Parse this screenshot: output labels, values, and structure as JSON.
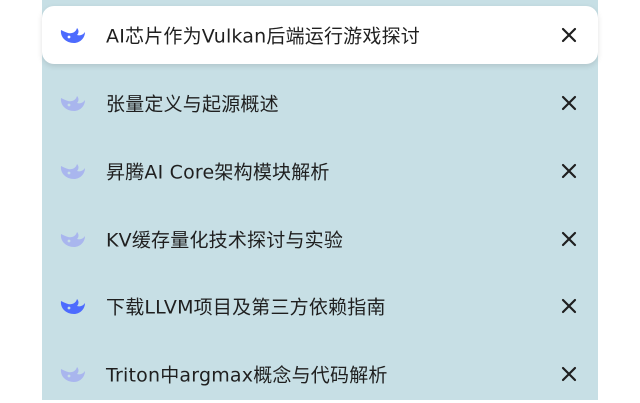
{
  "colors": {
    "panel_bg": "#c7dfe5",
    "active_bg": "#ffffff",
    "logo_strong": "#4d6bfe",
    "logo_faded": "#a9b6ee",
    "text": "#1f1f1f",
    "close": "#1f1f1f"
  },
  "conversations": [
    {
      "title": "AI芯片作为Vulkan后端运行游戏探讨",
      "active": true,
      "logo": "deepseek-whale-icon",
      "logo_style": "strong"
    },
    {
      "title": "张量定义与起源概述",
      "active": false,
      "logo": "deepseek-whale-icon",
      "logo_style": "faded"
    },
    {
      "title": "昇腾AI Core架构模块解析",
      "active": false,
      "logo": "deepseek-whale-icon",
      "logo_style": "faded"
    },
    {
      "title": "KV缓存量化技术探讨与实验",
      "active": false,
      "logo": "deepseek-whale-icon",
      "logo_style": "faded"
    },
    {
      "title": "下载LLVM项目及第三方依赖指南",
      "active": false,
      "logo": "deepseek-whale-icon",
      "logo_style": "strong"
    },
    {
      "title": "Triton中argmax概念与代码解析",
      "active": false,
      "logo": "deepseek-whale-icon",
      "logo_style": "faded"
    }
  ],
  "close_icon": "close-icon"
}
